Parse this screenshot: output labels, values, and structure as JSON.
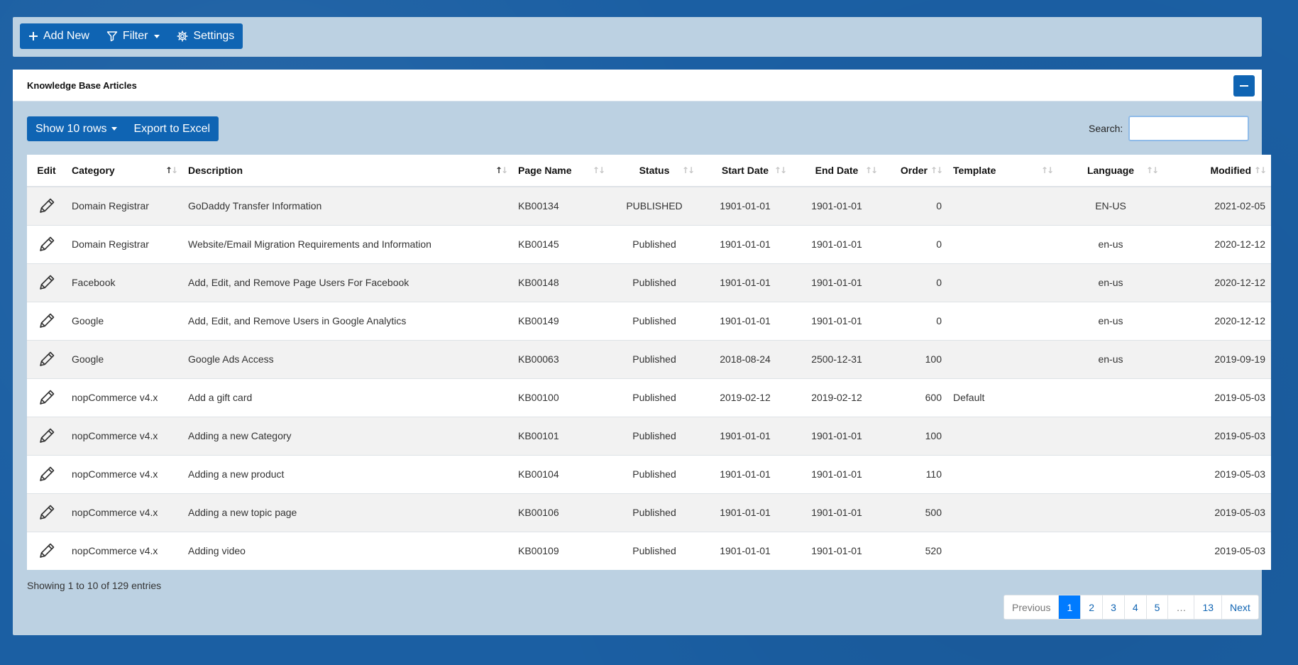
{
  "toolbar": {
    "add_new": "Add New",
    "filter": "Filter",
    "settings": "Settings"
  },
  "panel": {
    "title": "Knowledge Base Articles"
  },
  "table_tools": {
    "show_rows": "Show 10 rows",
    "export": "Export to Excel",
    "search_label": "Search:",
    "search_value": ""
  },
  "table": {
    "columns": [
      "Edit",
      "Category",
      "Description",
      "Page Name",
      "Status",
      "Start Date",
      "End Date",
      "Order",
      "Template",
      "Language",
      "Modified"
    ],
    "rows": [
      {
        "category": "Domain Registrar",
        "description": "GoDaddy Transfer Information",
        "page_name": "KB00134",
        "status": "PUBLISHED",
        "start": "1901-01-01",
        "end": "1901-01-01",
        "order": "0",
        "template": "",
        "language": "EN-US",
        "modified": "2021-02-05"
      },
      {
        "category": "Domain Registrar",
        "description": "Website/Email Migration Requirements and Information",
        "page_name": "KB00145",
        "status": "Published",
        "start": "1901-01-01",
        "end": "1901-01-01",
        "order": "0",
        "template": "",
        "language": "en-us",
        "modified": "2020-12-12"
      },
      {
        "category": "Facebook",
        "description": "Add, Edit, and Remove Page Users For Facebook",
        "page_name": "KB00148",
        "status": "Published",
        "start": "1901-01-01",
        "end": "1901-01-01",
        "order": "0",
        "template": "",
        "language": "en-us",
        "modified": "2020-12-12"
      },
      {
        "category": "Google",
        "description": "Add, Edit, and Remove Users in Google Analytics",
        "page_name": "KB00149",
        "status": "Published",
        "start": "1901-01-01",
        "end": "1901-01-01",
        "order": "0",
        "template": "",
        "language": "en-us",
        "modified": "2020-12-12"
      },
      {
        "category": "Google",
        "description": "Google Ads Access",
        "page_name": "KB00063",
        "status": "Published",
        "start": "2018-08-24",
        "end": "2500-12-31",
        "order": "100",
        "template": "",
        "language": "en-us",
        "modified": "2019-09-19"
      },
      {
        "category": "nopCommerce v4.x",
        "description": "Add a gift card",
        "page_name": "KB00100",
        "status": "Published",
        "start": "2019-02-12",
        "end": "2019-02-12",
        "order": "600",
        "template": "Default",
        "language": "",
        "modified": "2019-05-03"
      },
      {
        "category": "nopCommerce v4.x",
        "description": "Adding a new Category",
        "page_name": "KB00101",
        "status": "Published",
        "start": "1901-01-01",
        "end": "1901-01-01",
        "order": "100",
        "template": "",
        "language": "",
        "modified": "2019-05-03"
      },
      {
        "category": "nopCommerce v4.x",
        "description": "Adding a new product",
        "page_name": "KB00104",
        "status": "Published",
        "start": "1901-01-01",
        "end": "1901-01-01",
        "order": "110",
        "template": "",
        "language": "",
        "modified": "2019-05-03"
      },
      {
        "category": "nopCommerce v4.x",
        "description": "Adding a new topic page",
        "page_name": "KB00106",
        "status": "Published",
        "start": "1901-01-01",
        "end": "1901-01-01",
        "order": "500",
        "template": "",
        "language": "",
        "modified": "2019-05-03"
      },
      {
        "category": "nopCommerce v4.x",
        "description": "Adding video",
        "page_name": "KB00109",
        "status": "Published",
        "start": "1901-01-01",
        "end": "1901-01-01",
        "order": "520",
        "template": "",
        "language": "",
        "modified": "2019-05-03"
      }
    ]
  },
  "info": "Showing 1 to 10 of 129 entries",
  "pagination": {
    "previous": "Previous",
    "pages": [
      "1",
      "2",
      "3",
      "4",
      "5",
      "…",
      "13"
    ],
    "next": "Next"
  },
  "colors": {
    "accent": "#0f64b3",
    "active_page": "#007bff",
    "panel_bg": "#bcd1e2",
    "page_bg": "#1b5fa3"
  },
  "icons": [
    "plus-icon",
    "filter-icon",
    "gear-icon",
    "pencil-icon",
    "minus-icon",
    "sort-icon"
  ]
}
